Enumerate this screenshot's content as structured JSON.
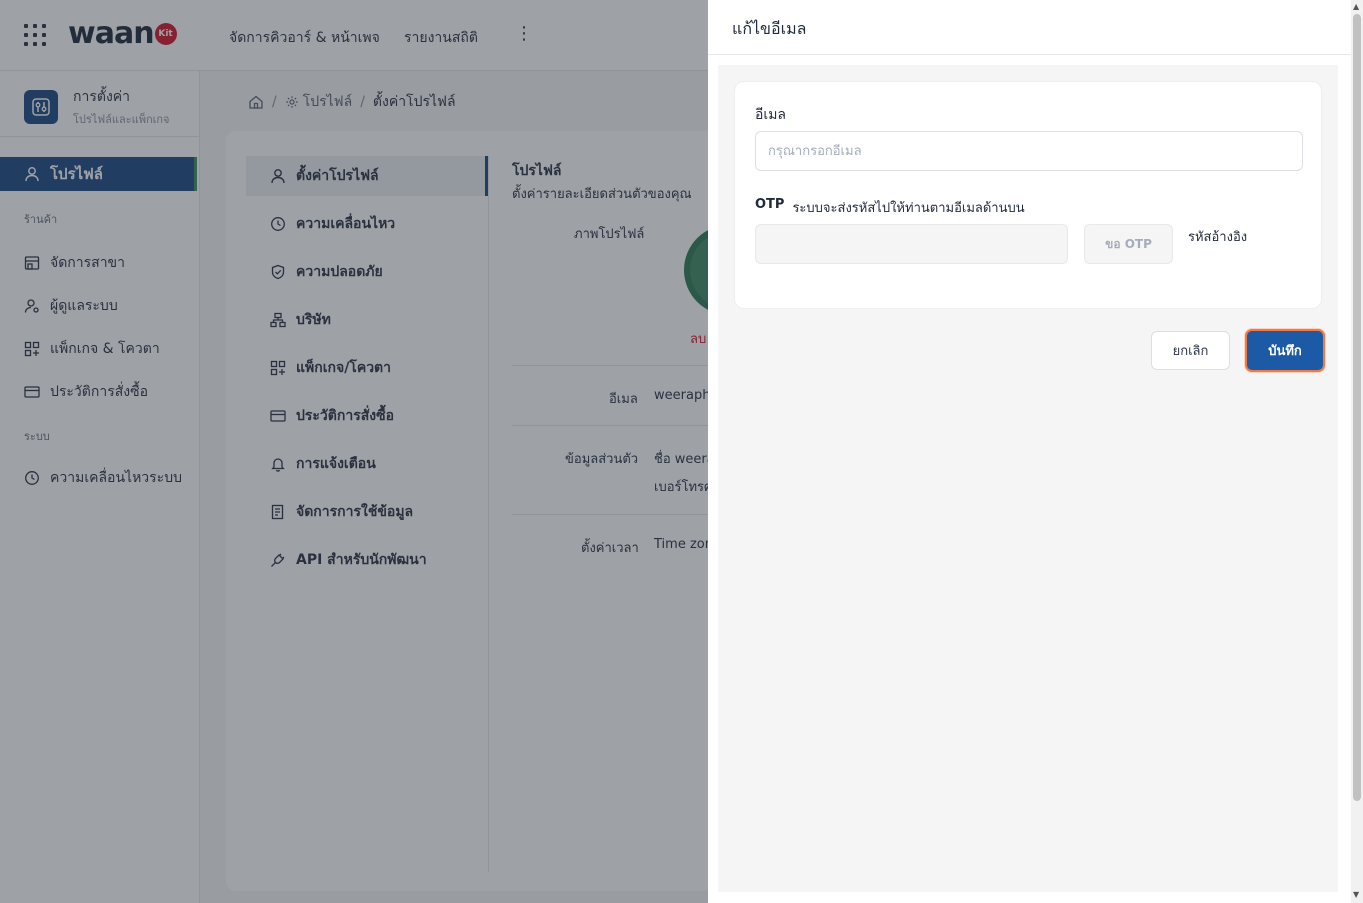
{
  "topbar": {
    "logo_text": "waan",
    "logo_badge": "Kit",
    "nav": [
      "จัดการคิวอาร์ & หน้าเพจ",
      "รายงานสถิติ"
    ],
    "more": "⋮"
  },
  "sidebar": {
    "header_title": "การตั้งค่า",
    "header_subtitle": "โปรไฟล์และแพ็กเกจ",
    "active_item": "โปรไฟล์",
    "section_store": "ร้านค้า",
    "store_items": [
      "จัดการสาขา",
      "ผู้ดูแลระบบ",
      "แพ็กเกจ & โควตา",
      "ประวัติการสั่งซื้อ"
    ],
    "section_system": "ระบบ",
    "system_items": [
      "ความเคลื่อนไหวระบบ"
    ]
  },
  "breadcrumb": {
    "items": [
      "โปรไฟล์",
      "ตั้งค่าโปรไฟล์"
    ],
    "sep": "/"
  },
  "profile_menu": [
    "ตั้งค่าโปรไฟล์",
    "ความเคลื่อนไหว",
    "ความปลอดภัย",
    "บริษัท",
    "แพ็กเกจ/โควตา",
    "ประวัติการสั่งซื้อ",
    "การแจ้งเตือน",
    "จัดการการใช้ข้อมูล",
    "API สำหรับนักพัฒนา"
  ],
  "profile": {
    "title": "โปรไฟล์",
    "subtitle": "ตั้งค่ารายละเอียดส่วนตัวของคุณ",
    "photo_label": "ภาพโปรไฟล์",
    "delete_label": "ลบ",
    "email_label": "อีเมล",
    "email_value": "weerapha",
    "personal_label": "ข้อมูลส่วนตัว",
    "name_value": "ชื่อ weera",
    "phone_value": "เบอร์โทรศ",
    "time_label": "ตั้งค่าเวลา",
    "time_value": "Time zon"
  },
  "drawer": {
    "title": "แก้ไขอีเมล",
    "email_label": "อีเมล",
    "email_placeholder": "กรุณากรอกอีเมล",
    "email_value": "",
    "otp_label": "OTP",
    "otp_hint": "ระบบจะส่งรหัสไปให้ท่านตามอีเมลด้านบน",
    "otp_button": "ขอ OTP",
    "ref_label": "รหัสอ้างอิง",
    "cancel_label": "ยกเลิก",
    "save_label": "บันทึก"
  },
  "colors": {
    "primary": "#1c4a86",
    "save_button": "#1c5aa6",
    "focus_ring": "#f07a45",
    "danger": "#d3172f",
    "avatar": "#3f8a65"
  }
}
